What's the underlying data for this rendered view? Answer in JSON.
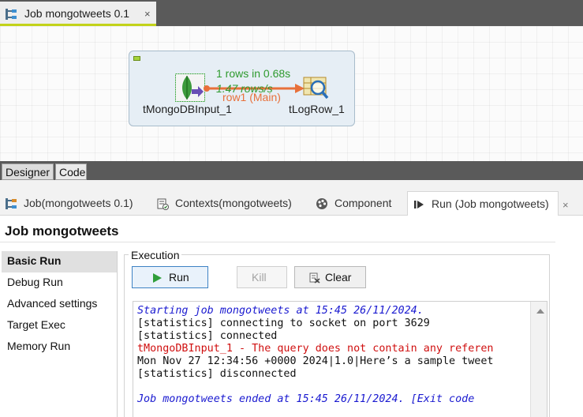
{
  "editor": {
    "tab_title": "Job mongotweets 0.1",
    "close_glyph": "×",
    "tab_icon": "job-icon",
    "accent_color": "#c2d21a"
  },
  "canvas": {
    "components": [
      {
        "label": "tMongoDBInput_1",
        "icon": "mongodb-icon"
      },
      {
        "label": "tLogRow_1",
        "icon": "log-row-icon"
      }
    ],
    "link": {
      "rows_stat": "1 rows in 0.68s",
      "rate_stat": "1.47 rows/s",
      "name": "row1 (Main)",
      "color": "#e8703a",
      "stat_color": "#2e9a2e"
    }
  },
  "view_switch": {
    "designer_label": "Designer",
    "code_label": "Code"
  },
  "view_tabs": [
    {
      "label": "Job(mongotweets 0.1)",
      "icon": "job-icon"
    },
    {
      "label": "Contexts(mongotweets)",
      "icon": "contexts-icon"
    },
    {
      "label": "Component",
      "icon": "component-icon"
    },
    {
      "label": "Run (Job mongotweets)",
      "icon": "run-view-icon",
      "active": true
    }
  ],
  "view_close_glyph": "×",
  "run": {
    "title": "Job mongotweets",
    "nav_items": [
      "Basic Run",
      "Debug Run",
      "Advanced settings",
      "Target Exec",
      "Memory Run"
    ],
    "selected_nav": "Basic Run",
    "execution_label": "Execution",
    "buttons": {
      "run": "Run",
      "kill": "Kill",
      "clear": "Clear"
    },
    "console_lines": [
      {
        "text": "Starting job mongotweets at 15:45 26/11/2024.",
        "style": "blue-it"
      },
      {
        "text": "[statistics] connecting to socket on port 3629",
        "style": "black"
      },
      {
        "text": "[statistics] connected",
        "style": "black"
      },
      {
        "text": "tMongoDBInput_1 - The query does not contain any referen",
        "style": "red"
      },
      {
        "text": "Mon Nov 27 12:34:56 +0000 2024|1.0|Here’s a sample tweet",
        "style": "black"
      },
      {
        "text": "[statistics] disconnected",
        "style": "black"
      },
      {
        "text": "",
        "style": "black"
      },
      {
        "text": "Job mongotweets ended at 15:45 26/11/2024. [Exit code",
        "style": "blue-it"
      }
    ]
  }
}
